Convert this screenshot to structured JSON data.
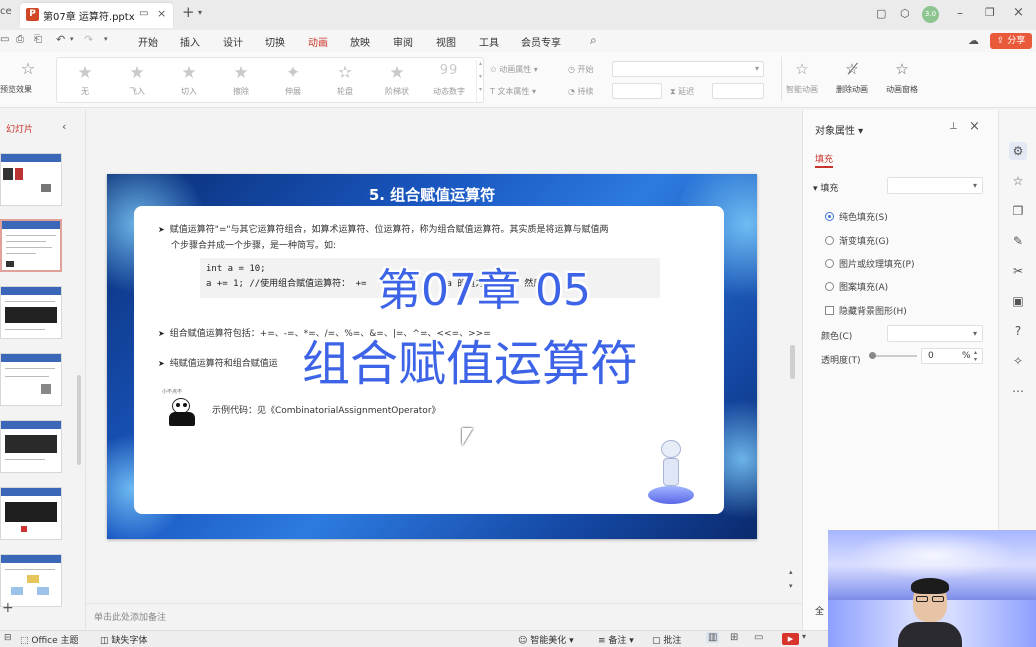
{
  "titlebar": {
    "app_fragment": "ce",
    "doc_tab": "第07章 运算符.pptx",
    "avatar": "3.0"
  },
  "ribbon_tabs": [
    "开始",
    "插入",
    "设计",
    "切换",
    "动画",
    "放映",
    "审阅",
    "视图",
    "工具",
    "会员专享"
  ],
  "active_tab": "动画",
  "share_label": "分享",
  "toolbar": {
    "left_label": "预览效果",
    "effects": [
      "无",
      "飞入",
      "切入",
      "擦除",
      "伸展",
      "轮盘",
      "阶梯状",
      "动态数字"
    ],
    "effect_icon_dynamic": "99",
    "anim_props": "动画属性",
    "text_props": "文本属性",
    "start_label": "开始",
    "duration_label": "持续",
    "delay_label": "延迟",
    "add_anim": "智能动画",
    "remove_anim": "删除动画",
    "anim_pane": "动画窗格"
  },
  "left_panel": {
    "title": "幻灯片"
  },
  "slide": {
    "title": "5. 组合赋值运算符",
    "bullet1_line1": "赋值运算符\"=\"与其它运算符组合，如算术运算符、位运算符，称为组合赋值运算符。其实质是将运算与赋值两",
    "bullet1_line2": "个步骤合并成一个步骤，是一种简写。如:",
    "code_line1": "int a = 10;",
    "code_line2": "a += 1; //使用组合赋值运算符： +=",
    "code_line2_tail": "a 的值为",
    "code_line2_end": "然后",
    "bullet2": "组合赋值运算符包括：+=、-=、*=、/=、%=、&=、|=、^=、<<=、>>=",
    "bullet3": "纯赋值运算符和组合赋值运",
    "example": "示例代码：见《CombinatorialAssignmentOperator》",
    "mascot_text": "小不点不"
  },
  "overlay": {
    "line1": "第07章 05",
    "line2": "组合赋值运算符"
  },
  "notes_placeholder": "单击此处添加备注",
  "right_panel": {
    "title": "对象属性",
    "subtab": "填充",
    "fill_section": "填充",
    "options": [
      "纯色填充(S)",
      "渐变填充(G)",
      "图片或纹理填充(P)",
      "图案填充(A)"
    ],
    "selected_option": 0,
    "hide_bg": "隐藏背景图形(H)",
    "color_label": "颜色(C)",
    "transparency_label": "透明度(T)",
    "transparency_value": "0",
    "transparency_unit": "%"
  },
  "side_more": "全",
  "statusbar": {
    "theme": "Office 主题",
    "missing_font": "缺失字体",
    "beautify": "智能美化",
    "notes": "备注",
    "comments": "批注"
  },
  "colors": {
    "accent": "#c9342a",
    "overlay_text": "#3d63e6",
    "slide_bg": "#1a58c2"
  }
}
